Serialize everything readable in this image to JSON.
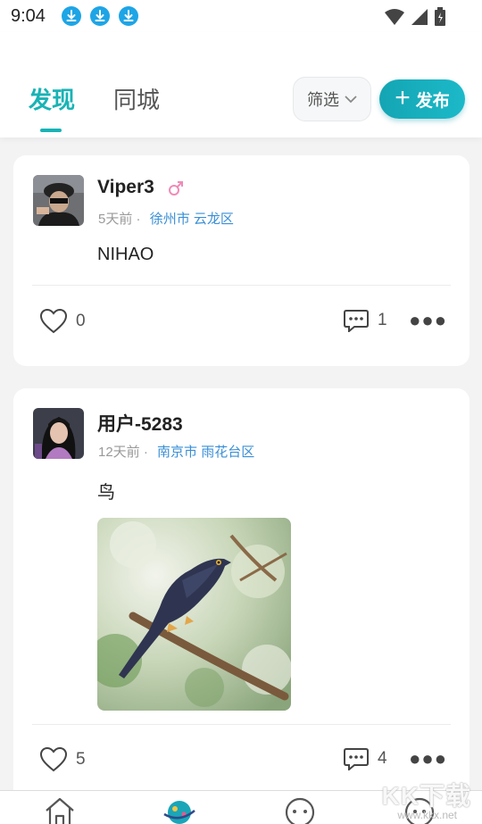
{
  "status_bar": {
    "time": "9:04"
  },
  "header": {
    "tabs": [
      {
        "label": "发现"
      },
      {
        "label": "同城"
      }
    ],
    "filter_label": "筛选",
    "publish_label": "发布"
  },
  "posts": [
    {
      "username": "Viper3",
      "time": "5天前",
      "location": "徐州市 云龙区",
      "content": "NIHAO",
      "likes": "0",
      "comments": "1"
    },
    {
      "username": "用户-5283",
      "time": "12天前",
      "location": "南京市 雨花台区",
      "content": "鸟",
      "likes": "5",
      "comments": "4"
    }
  ],
  "watermark": {
    "main": "KK下载",
    "sub": "www.kkx.net"
  },
  "colors": {
    "accent": "#19b3b5",
    "location": "#3a8fd6",
    "gender_male": "#f08ab7"
  }
}
